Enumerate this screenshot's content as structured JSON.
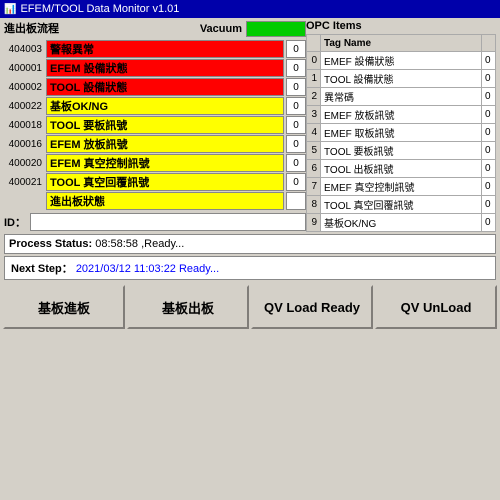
{
  "window": {
    "title": "EFEM/TOOL Data Monitor v1.01"
  },
  "leftPanel": {
    "sectionTitle": "進出板流程",
    "vacuumLabel": "Vacuum",
    "rows": [
      {
        "id": "404003",
        "label": "警報異常",
        "color": "red",
        "value": "0"
      },
      {
        "id": "400001",
        "label": "EFEM 設備狀態",
        "color": "red",
        "value": "0"
      },
      {
        "id": "400002",
        "label": "TOOL 設備狀態",
        "color": "red",
        "value": "0"
      },
      {
        "id": "400022",
        "label": "基板OK/NG",
        "color": "yellow",
        "value": "0"
      },
      {
        "id": "400018",
        "label": "TOOL 要板訊號",
        "color": "yellow",
        "value": "0"
      },
      {
        "id": "400016",
        "label": "EFEM 放板訊號",
        "color": "yellow",
        "value": "0"
      },
      {
        "id": "400020",
        "label": "EFEM 真空控制訊號",
        "color": "yellow",
        "value": "0"
      },
      {
        "id": "400021",
        "label": "TOOL 真空回覆訊號",
        "color": "yellow",
        "value": "0"
      },
      {
        "id": "",
        "label": "進出板狀態",
        "color": "yellow",
        "value": ""
      }
    ],
    "idLabel": "ID：",
    "idValue": ""
  },
  "rightPanel": {
    "sectionTitle": "OPC Items",
    "tagNameHeader": "Tag Name",
    "rows": [
      {
        "num": "0",
        "name": "EMEF 設備狀態",
        "value": "0"
      },
      {
        "num": "1",
        "name": "TOOL 設備狀態",
        "value": "0"
      },
      {
        "num": "2",
        "name": "異常碼",
        "value": "0"
      },
      {
        "num": "3",
        "name": "EMEF 放板訊號",
        "value": "0"
      },
      {
        "num": "4",
        "name": "EMEF 取板訊號",
        "value": "0"
      },
      {
        "num": "5",
        "name": "TOOL 要板訊號",
        "value": "0"
      },
      {
        "num": "6",
        "name": "TOOL 出板訊號",
        "value": "0"
      },
      {
        "num": "7",
        "name": "EMEF 真空控制訊號",
        "value": "0"
      },
      {
        "num": "8",
        "name": "TOOL 真空回覆訊號",
        "value": "0"
      },
      {
        "num": "9",
        "name": "基板OK/NG",
        "value": "0"
      }
    ]
  },
  "statusBar": {
    "label": "Process Status:",
    "value": "08:58:58 ,Ready..."
  },
  "nextStep": {
    "label": "Next Step：",
    "value": "2021/03/12 11:03:22 Ready..."
  },
  "buttons": [
    {
      "id": "btn-load-in",
      "label": "基板進板"
    },
    {
      "id": "btn-load-out",
      "label": "基板出板"
    },
    {
      "id": "btn-qv-load-ready",
      "label": "QV Load Ready"
    },
    {
      "id": "btn-qv-unload",
      "label": "QV UnLoad"
    }
  ],
  "colors": {
    "red": "#ff0000",
    "yellow": "#ffff00",
    "green": "#00cc00",
    "blue": "#0000ff",
    "titleBar": "#0000aa"
  }
}
